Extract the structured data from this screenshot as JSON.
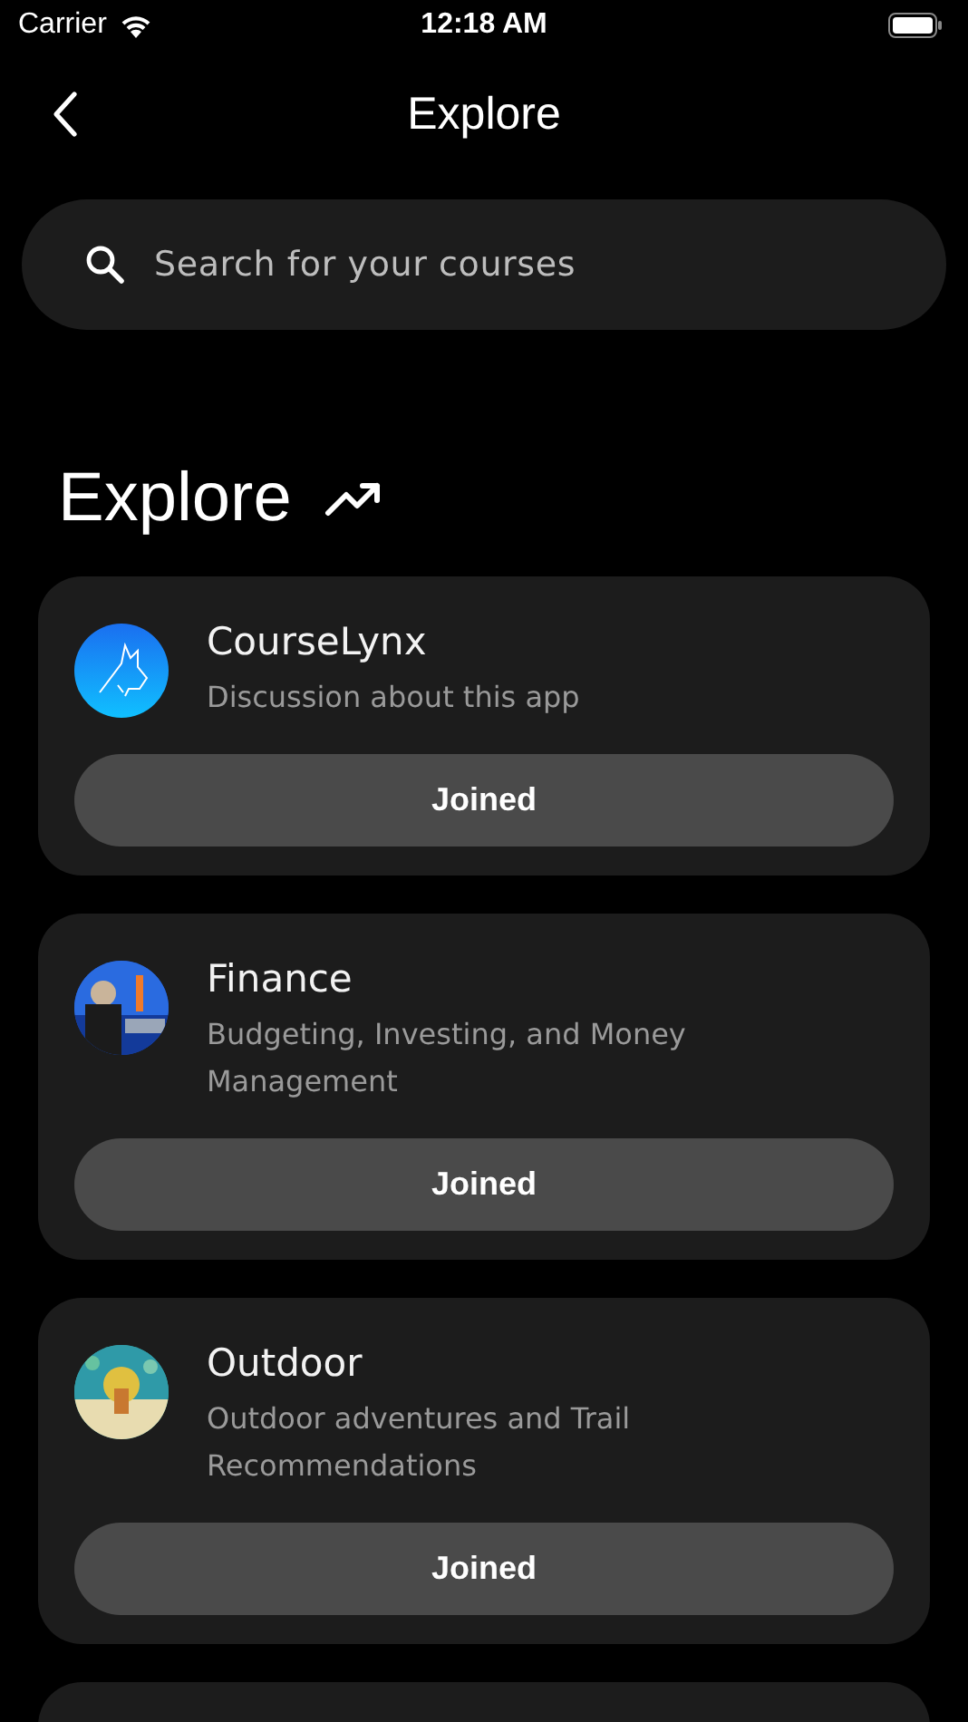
{
  "status_bar": {
    "carrier": "Carrier",
    "time": "12:18 AM"
  },
  "nav": {
    "title": "Explore"
  },
  "search": {
    "placeholder": "Search for your courses"
  },
  "section": {
    "title": "Explore"
  },
  "courses": [
    {
      "name": "CourseLynx",
      "description": "Discussion about this app",
      "avatar": {
        "kind": "logo"
      },
      "button": "Joined"
    },
    {
      "name": "Finance",
      "description": "Budgeting, Investing, and Money Management",
      "button": "Joined"
    },
    {
      "name": "Outdoor",
      "description": "Outdoor adventures and Trail Recommendations",
      "button": "Joined"
    }
  ]
}
